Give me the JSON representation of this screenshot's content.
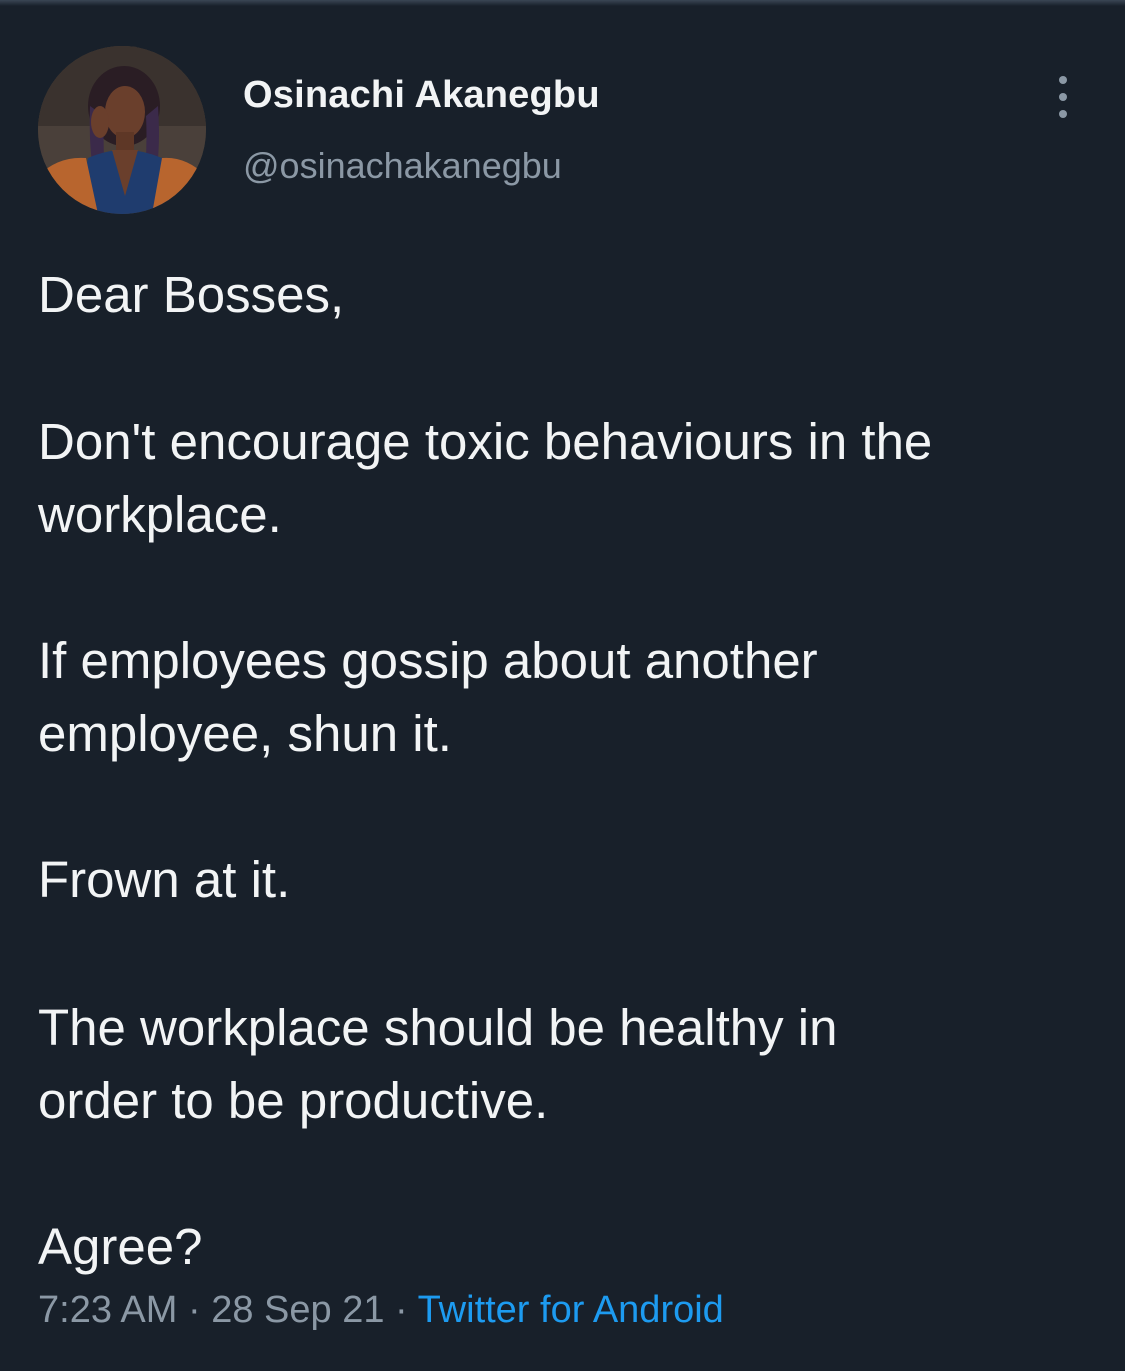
{
  "tweet": {
    "author": {
      "display_name": "Osinachi Akanegbu",
      "handle": "@osinachakanegbu"
    },
    "paragraphs": [
      [
        "Dear Bosses,"
      ],
      [
        "Don't encourage toxic behaviours in the",
        "workplace."
      ],
      [
        "If employees gossip about another",
        "employee, shun it."
      ],
      [
        "Frown at it."
      ],
      [
        "The workplace should be healthy in",
        "order to be productive."
      ],
      [
        "Agree?"
      ]
    ],
    "meta": {
      "time": "7:23 AM",
      "separator": " · ",
      "date": "28 Sep 21",
      "source": "Twitter for Android"
    }
  },
  "colors": {
    "background": "#18202a",
    "text": "#f2f4f5",
    "muted": "#8b98a5",
    "link": "#1d9bf0"
  },
  "icons": {
    "more": "vertical-dots-icon"
  }
}
